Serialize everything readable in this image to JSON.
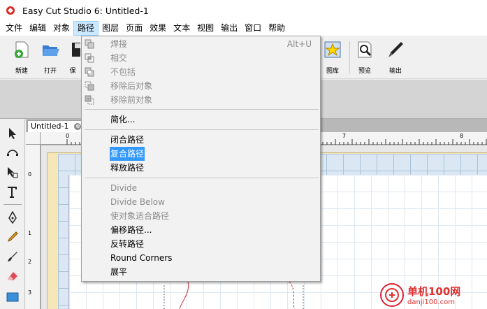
{
  "window": {
    "title": "Easy Cut Studio 6: Untitled-1"
  },
  "menubar": [
    "文件",
    "编辑",
    "对象",
    "路径",
    "图层",
    "页面",
    "效果",
    "文本",
    "视图",
    "输出",
    "窗口",
    "帮助"
  ],
  "toolbar": {
    "new_label": "新建",
    "open_label": "打开",
    "save_label": "保",
    "gallery_label": "图库",
    "preview_label": "预览",
    "output_label": "输出"
  },
  "document": {
    "tab_title": "Untitled-1",
    "close_glyph": "⊗"
  },
  "rulers": {
    "top": [
      "0",
      "7",
      "8"
    ],
    "left": [
      "0",
      "1",
      "2",
      "3"
    ]
  },
  "path_menu": {
    "weld": {
      "label": "焊接",
      "shortcut": "Alt+U"
    },
    "intersect": "相交",
    "exclude": "不包括",
    "remove_back": "移除后对象",
    "remove_front": "移除前对象",
    "simplify": "简化...",
    "close_path": "闭合路径",
    "compound_path": "复合路径",
    "release_path": "释放路径",
    "divide": "Divide",
    "divide_below": "Divide Below",
    "fit_to_path": "使对象适合路径",
    "offset_path": "偏移路径...",
    "reverse_path": "反转路径",
    "round_corners": "Round Corners",
    "flatten": "展平"
  },
  "watermark": {
    "name": "单机100网",
    "url": "danji100.com"
  },
  "colors": {
    "highlight": "#3399ff",
    "menu_active": "#cce8ff",
    "mat": "#f6e7b8",
    "grid": "#dbe8f3"
  }
}
